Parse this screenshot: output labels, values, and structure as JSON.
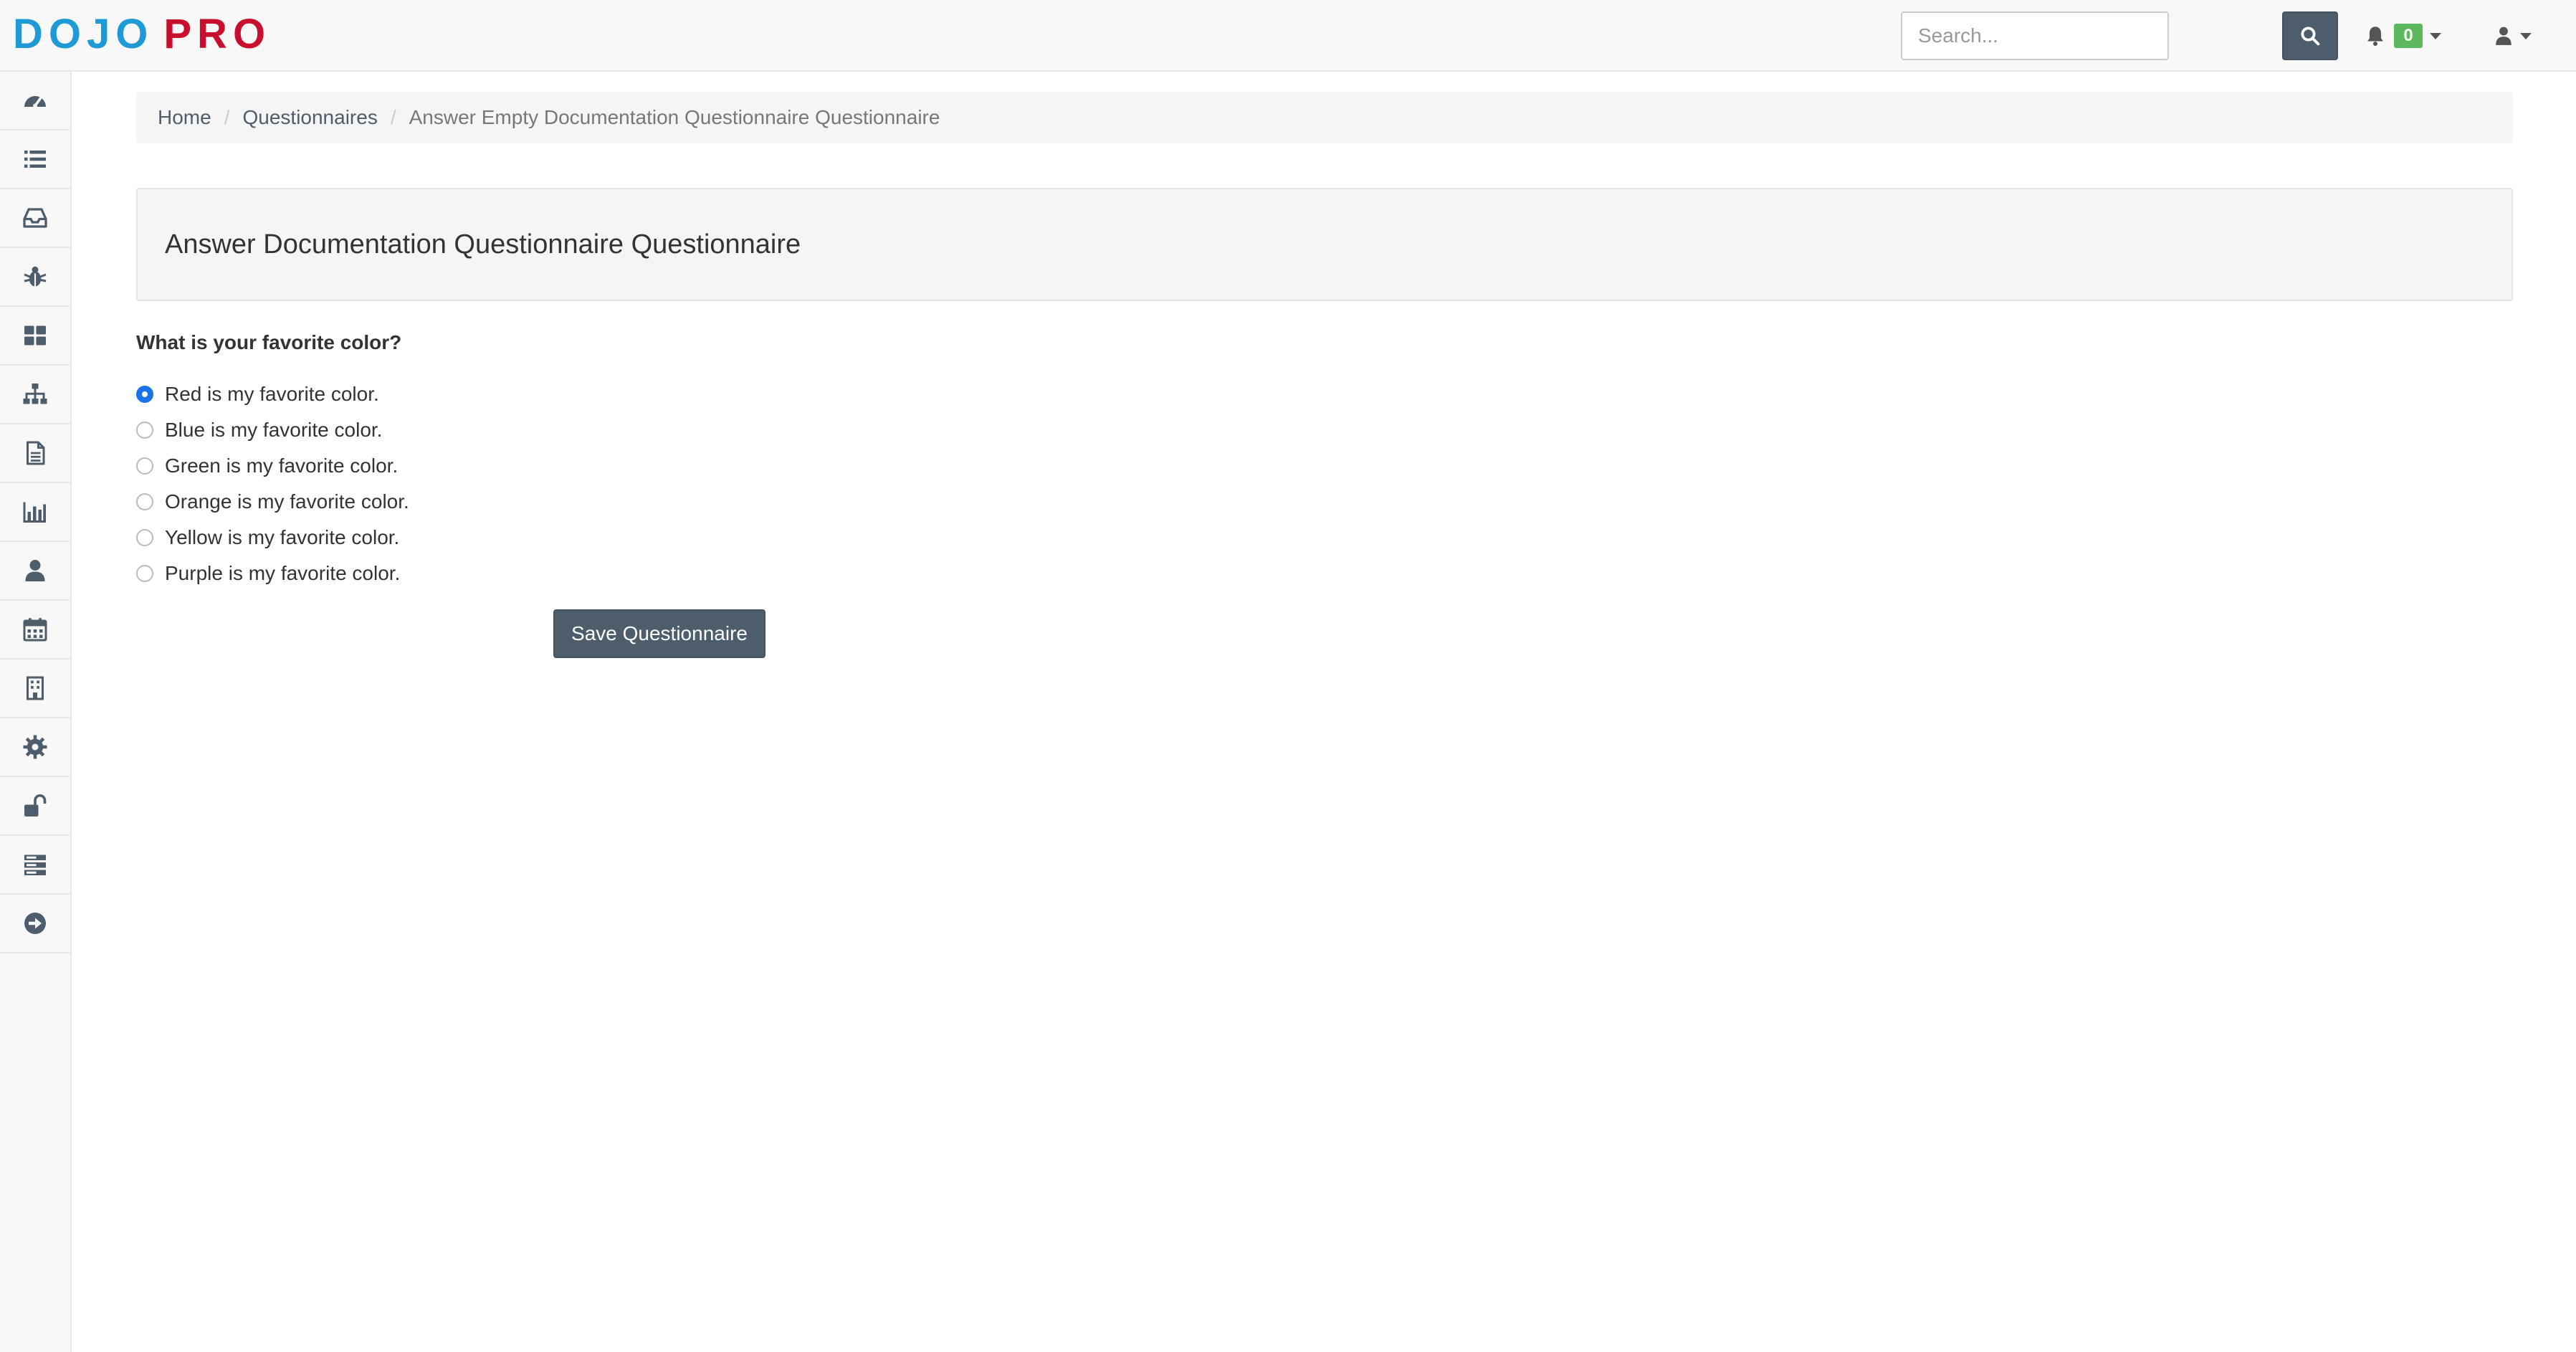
{
  "brand": {
    "logo_part1": "DOJO",
    "logo_part2": "PRO",
    "color_primary": "#1e9bd7",
    "color_secondary": "#c8102e"
  },
  "header": {
    "search_placeholder": "Search...",
    "search_icon": "search-icon",
    "notification_icon": "bell-icon",
    "notification_count": "0",
    "user_icon": "user-icon"
  },
  "sidebar": {
    "items": [
      {
        "icon": "dashboard-icon"
      },
      {
        "icon": "list-icon"
      },
      {
        "icon": "inbox-icon"
      },
      {
        "icon": "bug-icon"
      },
      {
        "icon": "grid-icon"
      },
      {
        "icon": "sitemap-icon"
      },
      {
        "icon": "document-icon"
      },
      {
        "icon": "bar-chart-icon"
      },
      {
        "icon": "user-icon"
      },
      {
        "icon": "calendar-icon"
      },
      {
        "icon": "building-icon"
      },
      {
        "icon": "gear-icon"
      },
      {
        "icon": "unlock-icon"
      },
      {
        "icon": "server-icon"
      },
      {
        "icon": "arrow-circle-right-icon"
      }
    ]
  },
  "breadcrumb": {
    "home": "Home",
    "questionnaires": "Questionnaires",
    "current": "Answer Empty Documentation Questionnaire Questionnaire"
  },
  "main": {
    "title": "Answer Documentation Questionnaire Questionnaire",
    "question": "What is your favorite color?",
    "choices": [
      "Red is my favorite color.",
      "Blue is my favorite color.",
      "Green is my favorite color.",
      "Orange is my favorite color.",
      "Yellow is my favorite color.",
      "Purple is my favorite color."
    ],
    "selected_index": 0,
    "save_label": "Save Questionnaire"
  },
  "colors": {
    "button_bg": "#4e5d6c",
    "badge_green": "#5cb85c",
    "radio_checked": "#1a73e8"
  }
}
